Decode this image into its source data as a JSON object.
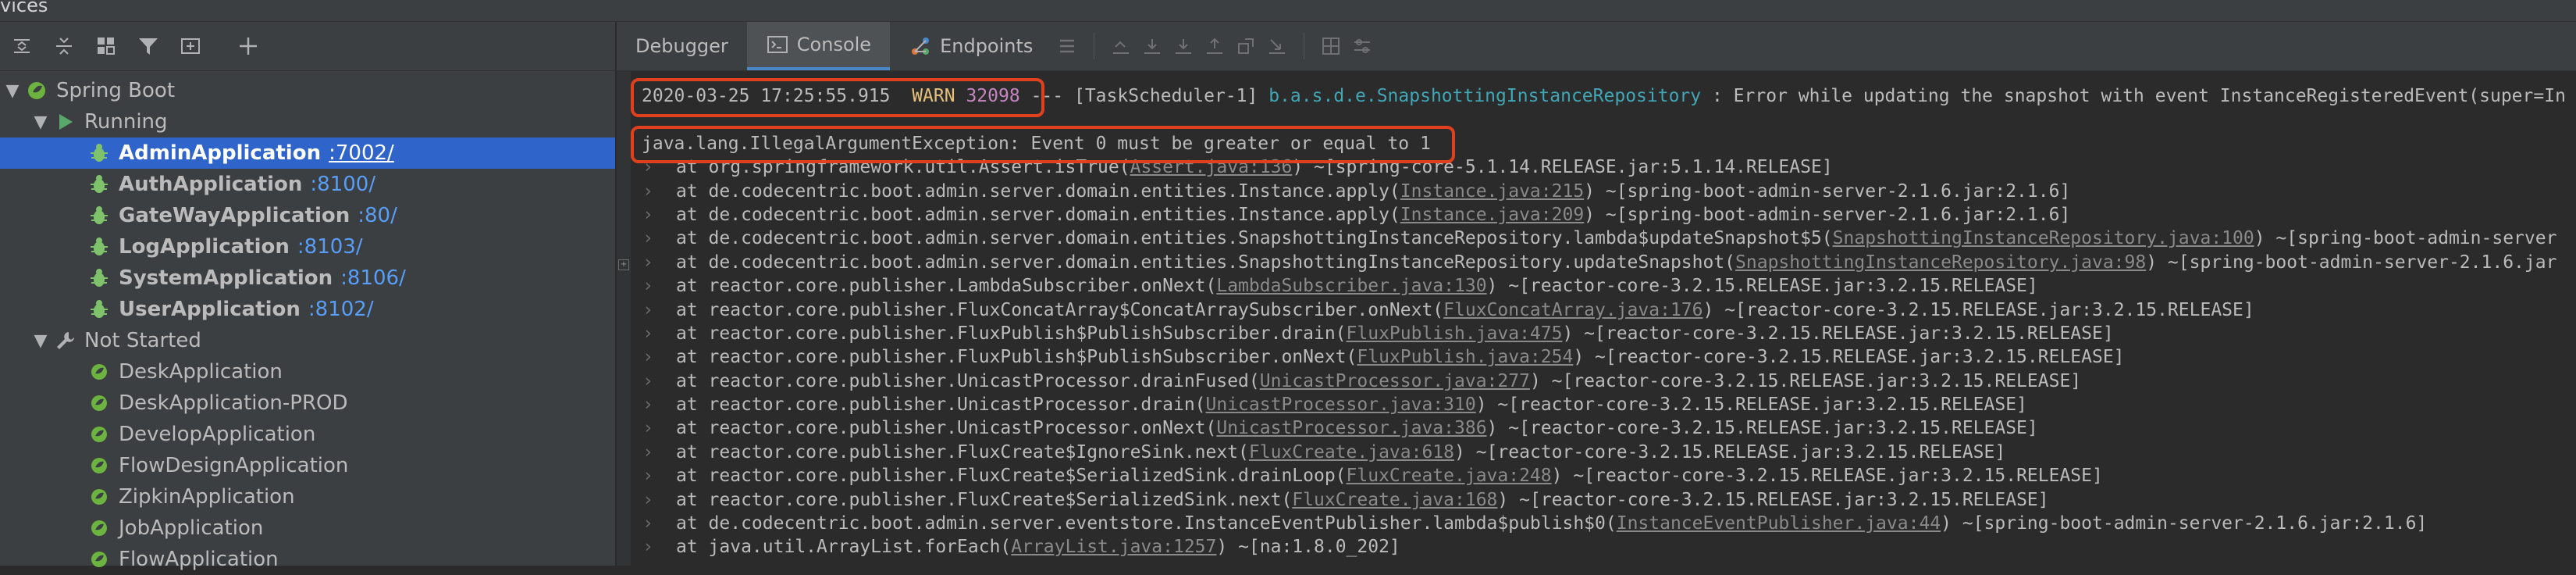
{
  "window": {
    "title": "vices"
  },
  "left_toolbar": {
    "icons": [
      "expand-all-icon",
      "collapse-all-icon",
      "group-icon",
      "filter-icon",
      "new-window-icon",
      "add-icon"
    ]
  },
  "tree": {
    "root": {
      "label": "Spring Boot"
    },
    "running": {
      "label": "Running",
      "apps": [
        {
          "name": "AdminApplication",
          "port": ":7002/"
        },
        {
          "name": "AuthApplication",
          "port": ":8100/"
        },
        {
          "name": "GateWayApplication",
          "port": ":80/"
        },
        {
          "name": "LogApplication",
          "port": ":8103/"
        },
        {
          "name": "SystemApplication",
          "port": ":8106/"
        },
        {
          "name": "UserApplication",
          "port": ":8102/"
        }
      ]
    },
    "not_started": {
      "label": "Not Started",
      "apps": [
        {
          "name": "DeskApplication"
        },
        {
          "name": "DeskApplication-PROD"
        },
        {
          "name": "DevelopApplication"
        },
        {
          "name": "FlowDesignApplication"
        },
        {
          "name": "ZipkinApplication"
        },
        {
          "name": "JobApplication"
        },
        {
          "name": "FlowApplication"
        }
      ]
    }
  },
  "tabs": {
    "debugger": "Debugger",
    "console": "Console",
    "endpoints": "Endpoints"
  },
  "console": {
    "first": {
      "timestamp": "2020-03-25 17:25:55.915",
      "level": "WARN",
      "pid": "32098",
      "sep": "---",
      "thread": "[TaskScheduler-1]",
      "logger": "b.a.s.d.e.SnapshottingInstanceRepository",
      "message": ": Error while updating the snapshot with event InstanceRegisteredEvent(super=In"
    },
    "exception": "java.lang.IllegalArgumentException: Event 0 must be greater or equal to 1",
    "stack": [
      {
        "pre": "at org.springframework.util.Assert.isTrue(",
        "link": "Assert.java:136",
        "post": ") ~[spring-core-5.1.14.RELEASE.jar:5.1.14.RELEASE]"
      },
      {
        "pre": "at de.codecentric.boot.admin.server.domain.entities.Instance.apply(",
        "link": "Instance.java:215",
        "post": ") ~[spring-boot-admin-server-2.1.6.jar:2.1.6]"
      },
      {
        "pre": "at de.codecentric.boot.admin.server.domain.entities.Instance.apply(",
        "link": "Instance.java:209",
        "post": ") ~[spring-boot-admin-server-2.1.6.jar:2.1.6]"
      },
      {
        "pre": "at de.codecentric.boot.admin.server.domain.entities.SnapshottingInstanceRepository.lambda$updateSnapshot$5(",
        "link": "SnapshottingInstanceRepository.java:100",
        "post": ") ~[spring-boot-admin-server"
      },
      {
        "pre": "at de.codecentric.boot.admin.server.domain.entities.SnapshottingInstanceRepository.updateSnapshot(",
        "link": "SnapshottingInstanceRepository.java:98",
        "post": ") ~[spring-boot-admin-server-2.1.6.jar"
      },
      {
        "pre": "at reactor.core.publisher.LambdaSubscriber.onNext(",
        "link": "LambdaSubscriber.java:130",
        "post": ") ~[reactor-core-3.2.15.RELEASE.jar:3.2.15.RELEASE]"
      },
      {
        "pre": "at reactor.core.publisher.FluxConcatArray$ConcatArraySubscriber.onNext(",
        "link": "FluxConcatArray.java:176",
        "post": ") ~[reactor-core-3.2.15.RELEASE.jar:3.2.15.RELEASE]"
      },
      {
        "pre": "at reactor.core.publisher.FluxPublish$PublishSubscriber.drain(",
        "link": "FluxPublish.java:475",
        "post": ") ~[reactor-core-3.2.15.RELEASE.jar:3.2.15.RELEASE]"
      },
      {
        "pre": "at reactor.core.publisher.FluxPublish$PublishSubscriber.onNext(",
        "link": "FluxPublish.java:254",
        "post": ") ~[reactor-core-3.2.15.RELEASE.jar:3.2.15.RELEASE]"
      },
      {
        "pre": "at reactor.core.publisher.UnicastProcessor.drainFused(",
        "link": "UnicastProcessor.java:277",
        "post": ") ~[reactor-core-3.2.15.RELEASE.jar:3.2.15.RELEASE]"
      },
      {
        "pre": "at reactor.core.publisher.UnicastProcessor.drain(",
        "link": "UnicastProcessor.java:310",
        "post": ") ~[reactor-core-3.2.15.RELEASE.jar:3.2.15.RELEASE]"
      },
      {
        "pre": "at reactor.core.publisher.UnicastProcessor.onNext(",
        "link": "UnicastProcessor.java:386",
        "post": ") ~[reactor-core-3.2.15.RELEASE.jar:3.2.15.RELEASE]"
      },
      {
        "pre": "at reactor.core.publisher.FluxCreate$IgnoreSink.next(",
        "link": "FluxCreate.java:618",
        "post": ") ~[reactor-core-3.2.15.RELEASE.jar:3.2.15.RELEASE]"
      },
      {
        "pre": "at reactor.core.publisher.FluxCreate$SerializedSink.drainLoop(",
        "link": "FluxCreate.java:248",
        "post": ") ~[reactor-core-3.2.15.RELEASE.jar:3.2.15.RELEASE]"
      },
      {
        "pre": "at reactor.core.publisher.FluxCreate$SerializedSink.next(",
        "link": "FluxCreate.java:168",
        "post": ") ~[reactor-core-3.2.15.RELEASE.jar:3.2.15.RELEASE]"
      },
      {
        "pre": "at de.codecentric.boot.admin.server.eventstore.InstanceEventPublisher.lambda$publish$0(",
        "link": "InstanceEventPublisher.java:44",
        "post": ") ~[spring-boot-admin-server-2.1.6.jar:2.1.6]"
      },
      {
        "pre": "at java.util.ArrayList.forEach(",
        "link": "ArrayList.java:1257",
        "post": ") ~[na:1.8.0_202]"
      }
    ]
  },
  "colors": {
    "selection": "#2f65ca",
    "port": "#589df6",
    "highlight": "#e1401f",
    "warn": "#e5c07b",
    "pid": "#c585c0",
    "logger": "#41a6b5"
  }
}
